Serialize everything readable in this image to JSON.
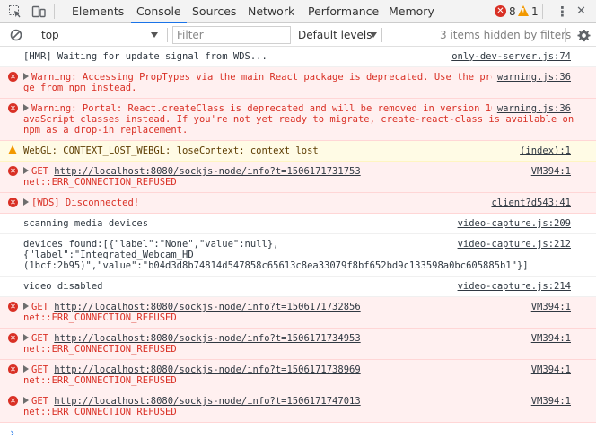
{
  "toolbar": {
    "tabs": [
      "Elements",
      "Console",
      "Sources",
      "Network",
      "Performance",
      "Memory"
    ],
    "active_tab": "Console",
    "error_count": "8",
    "warning_count": "1",
    "more_symbol": "⋮",
    "close_symbol": "✕"
  },
  "filterbar": {
    "context": "top",
    "filter_placeholder": "Filter",
    "levels": "Default levels",
    "hidden": "3 items hidden by filters"
  },
  "messages": [
    {
      "type": "log",
      "lines": [
        "[HMR] Waiting for update signal from WDS..."
      ],
      "source": "only-dev-server.js:74"
    },
    {
      "type": "error",
      "expandable": true,
      "lines": [
        "Warning: Accessing PropTypes via the main React package is deprecated. Use the prop-types package from npm instead."
      ],
      "source": "warning.js:36"
    },
    {
      "type": "error",
      "expandable": true,
      "lines": [
        "Warning: Portal: React.createClass is deprecated and will be removed in version 16. Use plain JavaScript classes instead. If you're not yet ready to migrate, create-react-class is available on npm as a drop-in replacement."
      ],
      "source": "warning.js:36"
    },
    {
      "type": "warning",
      "lines": [
        "WebGL: CONTEXT_LOST_WEBGL: loseContext: context lost"
      ],
      "source": "(index):1"
    },
    {
      "type": "error",
      "expandable": true,
      "get": "GET ",
      "url": "http://localhost:8080/sockjs-node/info?t=1506171731753",
      "tail": "net::ERR_CONNECTION_REFUSED",
      "source": "VM394:1"
    },
    {
      "type": "error",
      "expandable": true,
      "lines": [
        "[WDS] Disconnected!"
      ],
      "source": "client?d543:41"
    },
    {
      "type": "log",
      "lines": [
        "scanning media devices"
      ],
      "source": "video-capture.js:209"
    },
    {
      "type": "log",
      "lines": [
        "devices found:[{\"label\":\"None\",\"value\":null},\n{\"label\":\"Integrated_Webcam_HD\n(1bcf:2b95)\",\"value\":\"b04d3d8b74814d547858c65613c8ea33079f8bf652bd9c133598a0bc605885b1\"}]"
      ],
      "source": "video-capture.js:212"
    },
    {
      "type": "log",
      "lines": [
        "video disabled"
      ],
      "source": "video-capture.js:214"
    },
    {
      "type": "error",
      "expandable": true,
      "get": "GET ",
      "url": "http://localhost:8080/sockjs-node/info?t=1506171732856",
      "tail": "net::ERR_CONNECTION_REFUSED",
      "source": "VM394:1"
    },
    {
      "type": "error",
      "expandable": true,
      "get": "GET ",
      "url": "http://localhost:8080/sockjs-node/info?t=1506171734953",
      "tail": "net::ERR_CONNECTION_REFUSED",
      "source": "VM394:1"
    },
    {
      "type": "error",
      "expandable": true,
      "get": "GET ",
      "url": "http://localhost:8080/sockjs-node/info?t=1506171738969",
      "tail": "net::ERR_CONNECTION_REFUSED",
      "source": "VM394:1"
    },
    {
      "type": "error",
      "expandable": true,
      "get": "GET ",
      "url": "http://localhost:8080/sockjs-node/info?t=1506171747013",
      "tail": "net::ERR_CONNECTION_REFUSED",
      "source": "VM394:1"
    }
  ],
  "prompt_symbol": "›",
  "colors": {
    "accent": "#1a73e8",
    "error": "#d93025",
    "warning": "#f29900"
  }
}
